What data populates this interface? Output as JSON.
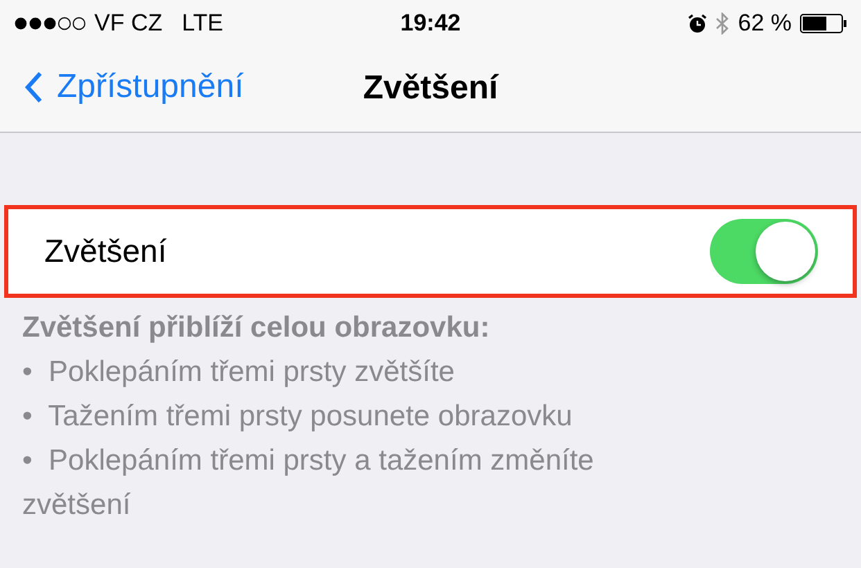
{
  "status_bar": {
    "carrier": "VF CZ",
    "network": "LTE",
    "time": "19:42",
    "battery": "62 %"
  },
  "nav_bar": {
    "back": "Zpřístupnění",
    "title": "Zvětšení"
  },
  "setting": {
    "label": "Zvětšení",
    "on": true,
    "highlighted": true
  },
  "footer": {
    "heading": "Zvětšení přiblíží celou obrazovku:",
    "items": [
      "•  Poklepáním třemi prsty zvětšíte",
      "•  Tažením třemi prsty posunete obrazovku",
      "•  Poklepáním třemi prsty a tažením změníte zvětšení"
    ]
  }
}
